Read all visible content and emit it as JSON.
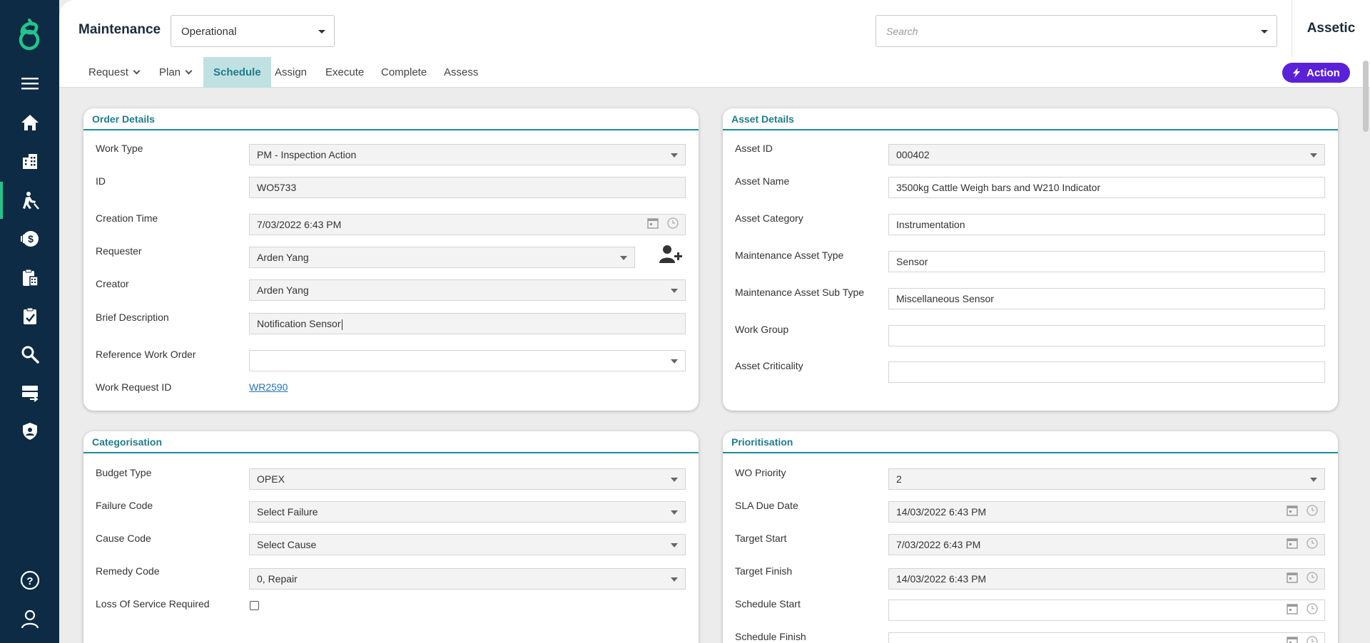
{
  "sidebar": {
    "items": [
      {
        "name": "menu-icon"
      },
      {
        "name": "home-icon"
      },
      {
        "name": "building-icon"
      },
      {
        "name": "maintenance-worker-icon"
      },
      {
        "name": "finance-icon"
      },
      {
        "name": "clipboard-icon"
      },
      {
        "name": "task-icon"
      },
      {
        "name": "search-icon"
      },
      {
        "name": "server-icon"
      },
      {
        "name": "shield-icon"
      },
      {
        "name": "help-icon"
      },
      {
        "name": "user-icon"
      }
    ],
    "active": "maintenance-worker-icon"
  },
  "header": {
    "title": "Maintenance",
    "mode_value": "Operational",
    "search_placeholder": "Search",
    "brand": "Assetic"
  },
  "tabs": [
    {
      "label": "Request",
      "dropdown": true
    },
    {
      "label": "Plan",
      "dropdown": true
    },
    {
      "label": "Schedule",
      "active": true
    },
    {
      "label": "Assign"
    },
    {
      "label": "Execute"
    },
    {
      "label": "Complete"
    },
    {
      "label": "Assess"
    }
  ],
  "action_label": "Action",
  "accent": "#1e8a99",
  "action_color": "#5b21d9",
  "order_details": {
    "title": "Order Details",
    "work_type_label": "Work Type",
    "work_type": "PM - Inspection Action",
    "id_label": "ID",
    "id": "WO5733",
    "creation_label": "Creation Time",
    "creation": "7/03/2022 6:43 PM",
    "requester_label": "Requester",
    "requester": "Arden Yang",
    "creator_label": "Creator",
    "creator": "Arden Yang",
    "brief_label": "Brief Description",
    "brief": "Notification Sensor",
    "ref_label": "Reference Work Order",
    "ref": "",
    "wr_label": "Work Request ID",
    "wr": "WR2590"
  },
  "asset_details": {
    "title": "Asset Details",
    "asset_id_label": "Asset ID",
    "asset_id": "000402",
    "asset_name_label": "Asset Name",
    "asset_name": "3500kg Cattle Weigh bars and W210 Indicator",
    "category_label": "Asset Category",
    "category": "Instrumentation",
    "mtype_label": "Maintenance Asset Type",
    "mtype": "Sensor",
    "msubtype_label": "Maintenance Asset Sub Type",
    "msubtype": "Miscellaneous Sensor",
    "work_group_label": "Work Group",
    "work_group": "",
    "criticality_label": "Asset Criticality",
    "criticality": ""
  },
  "categorisation": {
    "title": "Categorisation",
    "budget_label": "Budget Type",
    "budget": "OPEX",
    "failure_label": "Failure Code",
    "failure": "Select Failure",
    "cause_label": "Cause Code",
    "cause": "Select Cause",
    "remedy_label": "Remedy Code",
    "remedy": "0, Repair",
    "loss_label": "Loss Of Service Required"
  },
  "prioritisation": {
    "title": "Prioritisation",
    "priority_label": "WO Priority",
    "priority": "2",
    "sla_label": "SLA Due Date",
    "sla": "14/03/2022 6:43 PM",
    "tstart_label": "Target Start",
    "tstart": "7/03/2022 6:43 PM",
    "tfinish_label": "Target Finish",
    "tfinish": "14/03/2022 6:43 PM",
    "sstart_label": "Schedule Start",
    "sstart": "",
    "sfinish_label": "Schedule Finish",
    "sfinish": ""
  }
}
